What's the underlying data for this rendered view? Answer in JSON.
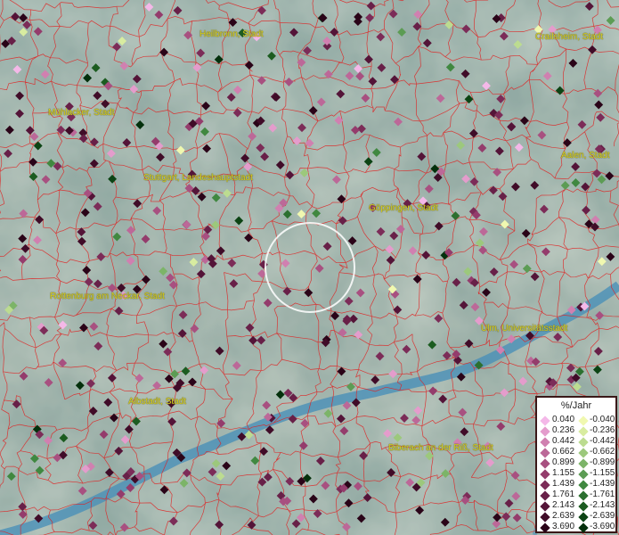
{
  "cities": [
    {
      "name": "Heilbronn, Stadt"
    },
    {
      "name": "Crailsheim, Stadt"
    },
    {
      "name": "Mühlacker, Stadt"
    },
    {
      "name": "Aalen, Stadt"
    },
    {
      "name": "Stuttgart, Landeshauptstadt"
    },
    {
      "name": "Göppingen, Stadt"
    },
    {
      "name": "Rottenburg am Neckar, Stadt"
    },
    {
      "name": "Ulm, Universitätsstadt"
    },
    {
      "name": "Albstadt, Stadt"
    },
    {
      "name": "Biberach an der Riß, Stadt"
    }
  ],
  "legend": {
    "title": "%/Jahr",
    "positive": [
      {
        "value": "0.040",
        "color": "#f4b8e8"
      },
      {
        "value": "0.236",
        "color": "#e49ccc"
      },
      {
        "value": "0.442",
        "color": "#d080b0"
      },
      {
        "value": "0.662",
        "color": "#bc6898"
      },
      {
        "value": "0.899",
        "color": "#a85080"
      },
      {
        "value": "1.155",
        "color": "#943c6c"
      },
      {
        "value": "1.439",
        "color": "#7c2c58"
      },
      {
        "value": "1.761",
        "color": "#682048"
      },
      {
        "value": "2.143",
        "color": "#541438"
      },
      {
        "value": "2.639",
        "color": "#400c28"
      },
      {
        "value": "3.690",
        "color": "#2a0418"
      }
    ],
    "negative": [
      {
        "value": "-0.040",
        "color": "#f0f8b0"
      },
      {
        "value": "-0.236",
        "color": "#d8eca0"
      },
      {
        "value": "-0.442",
        "color": "#bcdc90"
      },
      {
        "value": "-0.662",
        "color": "#9cc87c"
      },
      {
        "value": "-0.899",
        "color": "#7cb468"
      },
      {
        "value": "-1.155",
        "color": "#5c9c54"
      },
      {
        "value": "-1.439",
        "color": "#408840"
      },
      {
        "value": "-1.761",
        "color": "#2c7030"
      },
      {
        "value": "-2.143",
        "color": "#1c5c20"
      },
      {
        "value": "-2.639",
        "color": "#0c4414"
      },
      {
        "value": "-3.690",
        "color": "#04300c"
      }
    ]
  },
  "colors": {
    "boundary": "#e02020",
    "river": "#4a90b8",
    "label": "#d8d020"
  }
}
